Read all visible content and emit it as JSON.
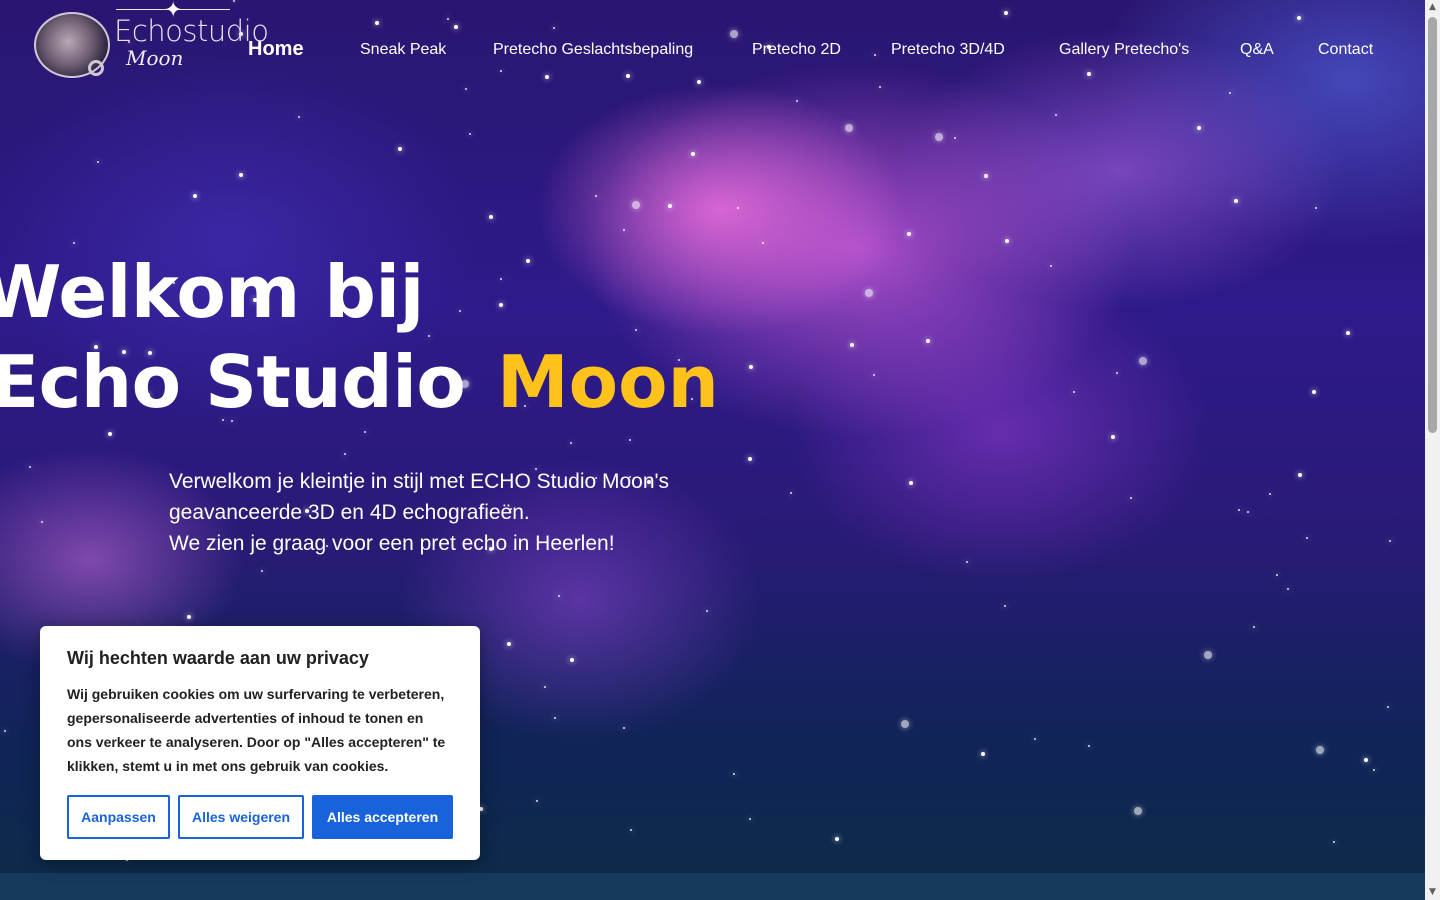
{
  "logo": {
    "name": "Echostudio",
    "sub": "Moon"
  },
  "nav": {
    "items": [
      {
        "label": "Home",
        "active": true
      },
      {
        "label": "Sneak Peak"
      },
      {
        "label": "Pretecho Geslachtsbepaling"
      },
      {
        "label": "Pretecho 2D"
      },
      {
        "label": "Pretecho 3D/4D"
      },
      {
        "label": "Gallery Pretecho's"
      },
      {
        "label": "Q&A"
      },
      {
        "label": "Contact"
      }
    ]
  },
  "hero": {
    "title_line1": "Welkom bij",
    "title_line2": "Echo Studio",
    "title_accent": "Moon",
    "desc_line1": "Verwelkom je kleintje in stijl met ECHO Studio Moon's",
    "desc_line2": "geavanceerde 3D en 4D echografieën.",
    "desc_line3": "We zien je graag voor een pret echo in Heerlen!"
  },
  "cookie": {
    "title": "Wij hechten waarde aan uw privacy",
    "text_line1": "Wij gebruiken cookies om uw surfervaring te verbeteren,",
    "text_line2": "gepersonaliseerde advertenties of inhoud te tonen en",
    "text_line3": "ons verkeer te analyseren. Door op \"Alles accepteren\" te",
    "text_line4": "klikken, stemt u in met ons gebruik van cookies.",
    "customize_label": "Aanpassen",
    "reject_label": "Alles weigeren",
    "accept_label": "Alles accepteren"
  },
  "colors": {
    "accent": "#ffc21a",
    "cookie_button": "#1863dc",
    "footer_strip": "#163a5e"
  },
  "icons": {
    "scroll_up": "scroll-up-arrow-icon",
    "scroll_down": "scroll-down-arrow-icon"
  }
}
